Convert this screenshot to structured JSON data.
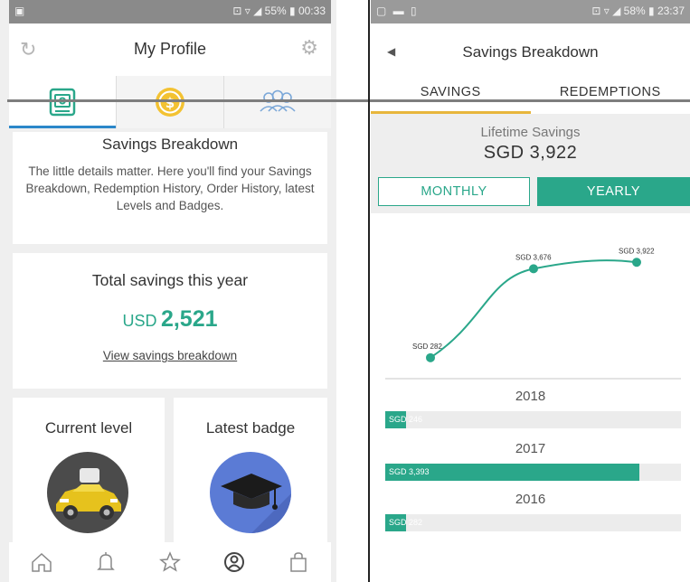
{
  "left": {
    "status": {
      "left": "▣",
      "right": "⊡ ▿ ◢ 55% ▮ 00:33"
    },
    "header": {
      "title": "My Profile"
    },
    "intro_card": {
      "title": "Savings Breakdown",
      "body": "The little details matter. Here you'll find your Savings Breakdown, Redemption History, Order History, latest Levels and Badges."
    },
    "savings_card": {
      "title": "Total savings this year",
      "currency": "USD",
      "amount": "2,521",
      "link": "View savings breakdown"
    },
    "level_card": {
      "title": "Current level"
    },
    "badge_card": {
      "title": "Latest badge"
    },
    "nav_icons": [
      "home-icon",
      "bell-icon",
      "star-icon",
      "profile-icon",
      "bag-icon"
    ]
  },
  "right": {
    "status": {
      "left": "▢ ▬ ▯",
      "right": "⊡ ▿ ◢ 58% ▮ 23:37"
    },
    "header": {
      "title": "Savings Breakdown"
    },
    "tabs": [
      "SAVINGS",
      "REDEMPTIONS"
    ],
    "lifetime_label": "Lifetime Savings",
    "lifetime_value": "SGD 3,922",
    "toggle": {
      "monthly": "MONTHLY",
      "yearly": "YEARLY"
    },
    "accent": "#2aa78a",
    "tab_accent": "#e7b63c",
    "bars": [
      {
        "year": "2018",
        "label": "SGD 246",
        "fraction": 0.07
      },
      {
        "year": "2017",
        "label": "SGD 3,393",
        "fraction": 0.86
      },
      {
        "year": "2016",
        "label": "SGD 282",
        "fraction": 0.07
      }
    ]
  },
  "chart_data": {
    "type": "line",
    "x": [
      1,
      2,
      3
    ],
    "values": [
      282,
      3676,
      3922
    ],
    "point_labels": [
      "SGD 282",
      "SGD 3,676",
      "SGD 3,922"
    ],
    "title": "",
    "xlabel": "",
    "ylabel": "",
    "grid": false
  }
}
